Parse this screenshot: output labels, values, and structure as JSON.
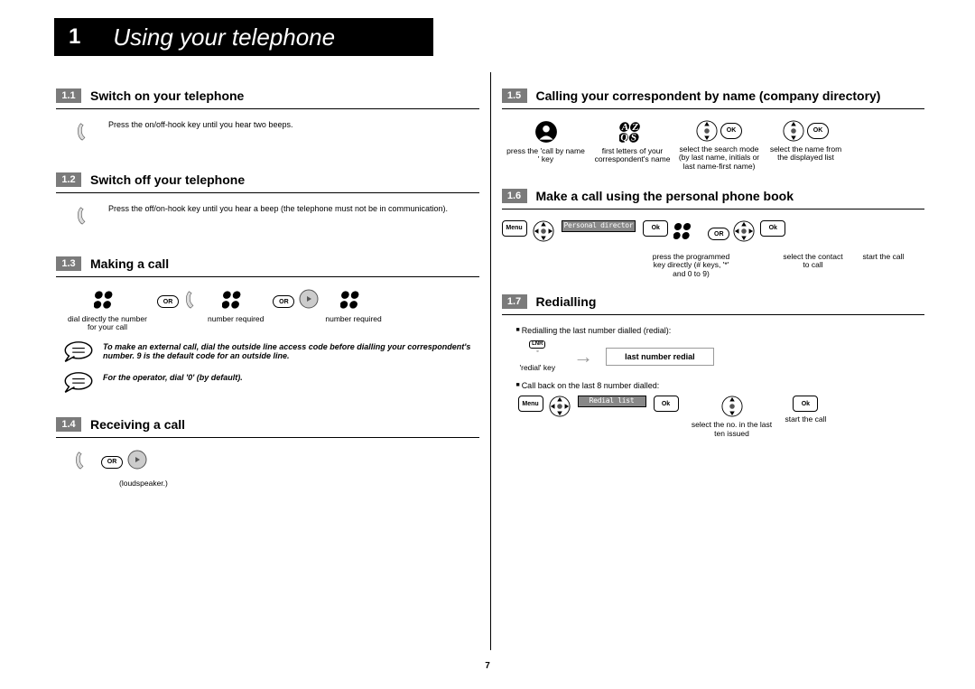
{
  "chapter": {
    "number": "1",
    "title": "Using your telephone"
  },
  "page_number": "7",
  "left": {
    "s11": {
      "num": "1.1",
      "title": "Switch on your telephone",
      "text": "Press the on/off-hook key until you hear two beeps."
    },
    "s12": {
      "num": "1.2",
      "title": "Switch off your telephone",
      "text": "Press the off/on-hook key until you hear a beep (the telephone must not be in communication)."
    },
    "s13": {
      "num": "1.3",
      "title": "Making a call",
      "cap1": "dial directly the number for your call",
      "cap2": "number required",
      "cap3": "number required",
      "or": "OR",
      "note1": "To make an external call, dial the outside line access code before dialling your correspondent's number. 9 is the default code for an outside line.",
      "note2": "For the operator, dial '0' (by default)."
    },
    "s14": {
      "num": "1.4",
      "title": "Receiving a call",
      "or": "OR",
      "cap": "(loudspeaker.)"
    }
  },
  "right": {
    "s15": {
      "num": "1.5",
      "title": "Calling your correspondent by name (company directory)",
      "cap1": "press the 'call by name ' key",
      "cap2": "first letters of your correspondent's name",
      "cap3": "select the search mode (by last name, initials or last name-first name)",
      "cap4": "select the name from the displayed list",
      "ok": "OK"
    },
    "s16": {
      "num": "1.6",
      "title": "Make a call using the personal phone book",
      "menu": "Menu",
      "ok": "Ok",
      "or": "OR",
      "lcd": "Personal director",
      "cap1": "press the programmed key directly (# keys, '*' and 0 to 9)",
      "cap2": "select the contact to call",
      "cap3": "start the call"
    },
    "s17": {
      "num": "1.7",
      "title": "Redialling",
      "bullet1": "Redialling the last number dialled (redial):",
      "bullet2": "Call back on the last 8 number dialled:",
      "lnr": "LNR",
      "redial_cap": "'redial' key",
      "result": "last number redial",
      "menu": "Menu",
      "ok": "Ok",
      "lcd": "Redial list",
      "cap1": "select the no. in the last ten issued",
      "cap2": "start the call"
    }
  }
}
